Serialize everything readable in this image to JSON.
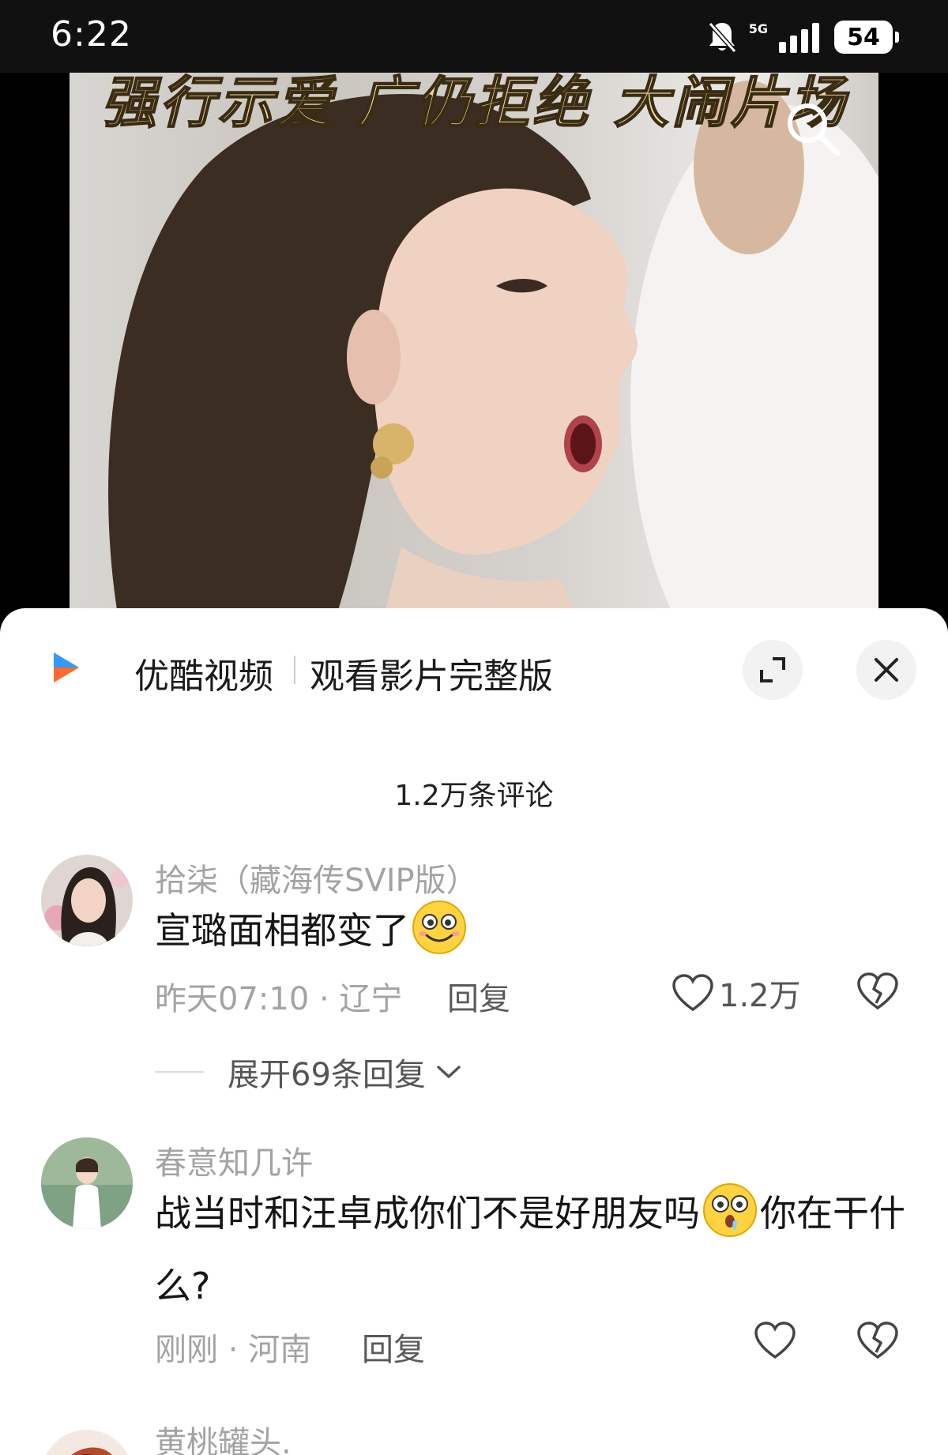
{
  "status_bar": {
    "time": "6:22",
    "network": "5G",
    "battery": "54",
    "icons": [
      "bell-off-icon",
      "signal-icon",
      "battery-icon"
    ]
  },
  "video": {
    "caption": "强行示爱 广仍拒绝 大闹片场",
    "icons": [
      "search-icon"
    ]
  },
  "sheet": {
    "app_name": "优酷视频",
    "cta": "观看影片完整版",
    "icons": [
      "youku-logo-icon",
      "expand-icon",
      "close-icon"
    ],
    "comment_count": "1.2万条评论"
  },
  "comments": [
    {
      "username": "拾柒（藏海传SVIP版）",
      "text": "宣璐面相都变了",
      "emoji": "grinning-emoji-icon",
      "meta": "昨天07:10 · 辽宁",
      "reply": "回复",
      "likes": "1.2万",
      "expand": "展开69条回复"
    },
    {
      "username": "春意知几许",
      "text_a": "战当时和汪卓成你们不是好朋友吗",
      "emoji": "shocked-emoji-icon",
      "text_b": "你在干什么?",
      "meta": "刚刚 · 河南",
      "reply": "回复"
    },
    {
      "username": "黄桃罐头."
    }
  ],
  "colors": {
    "sheet_bg": "#ffffff",
    "muted_text": "#a3a3a3",
    "primary_text": "#151515",
    "youku_blue": "#2f9bff",
    "youku_orange": "#ff6a2b"
  }
}
